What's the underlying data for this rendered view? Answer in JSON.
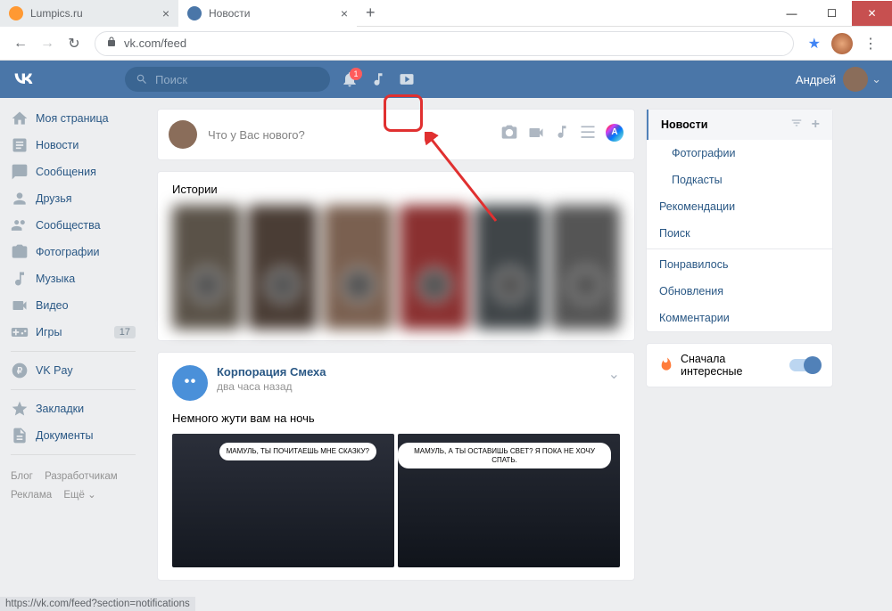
{
  "window": {
    "min": "—",
    "max": "☐",
    "close": "✕"
  },
  "tabs": [
    {
      "title": "Lumpics.ru",
      "favicon_color": "#ff9933"
    },
    {
      "title": "Новости",
      "favicon_color": "#4a76a8"
    }
  ],
  "new_tab": "+",
  "urlbar": {
    "back": "←",
    "forward": "→",
    "reload": "↻",
    "url": "vk.com/feed",
    "star": "★",
    "menu": "⋮"
  },
  "vk_header": {
    "search_placeholder": "Поиск",
    "notif_count": "1",
    "user_name": "Андрей"
  },
  "sidebar": {
    "items": [
      {
        "label": "Моя страница",
        "icon": "home"
      },
      {
        "label": "Новости",
        "icon": "news"
      },
      {
        "label": "Сообщения",
        "icon": "messages"
      },
      {
        "label": "Друзья",
        "icon": "friends"
      },
      {
        "label": "Сообщества",
        "icon": "groups"
      },
      {
        "label": "Фотографии",
        "icon": "camera"
      },
      {
        "label": "Музыка",
        "icon": "music"
      },
      {
        "label": "Видео",
        "icon": "video"
      },
      {
        "label": "Игры",
        "icon": "games",
        "badge": "17"
      }
    ],
    "vkpay": "VK Pay",
    "bookmarks": "Закладки",
    "docs": "Документы",
    "footer": {
      "blog": "Блог",
      "dev": "Разработчикам",
      "ads": "Реклама",
      "more": "Ещё ⌄"
    }
  },
  "composer": {
    "placeholder": "Что у Вас нового?",
    "color_letter": "A"
  },
  "stories": {
    "title": "Истории"
  },
  "feed": {
    "author": "Корпорация Смеха",
    "time": "два часа назад",
    "text": "Немного жути вам на ночь",
    "bubble1": "МАМУЛЬ,\nТЫ ПОЧИТАЕШЬ МНЕ\nСКАЗКУ?",
    "bubble2": "МАМУЛЬ, А ТЫ\nОСТАВИШЬ СВЕТ? Я ПОКА\nНЕ ХОЧУ СПАТЬ."
  },
  "right": {
    "tabs": [
      {
        "label": "Новости",
        "active": true,
        "actions": true
      },
      {
        "label": "Фотографии",
        "sub": true
      },
      {
        "label": "Подкасты",
        "sub": true
      },
      {
        "label": "Рекомендации"
      },
      {
        "label": "Поиск"
      }
    ],
    "tabs2": [
      {
        "label": "Понравилось"
      },
      {
        "label": "Обновления"
      },
      {
        "label": "Комментарии"
      }
    ],
    "priority": "Сначала интересные"
  },
  "status": "https://vk.com/feed?section=notifications"
}
